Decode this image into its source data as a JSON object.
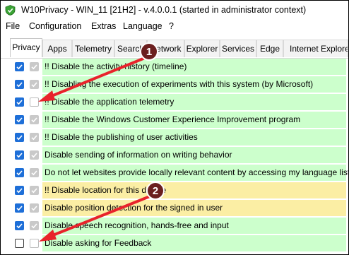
{
  "window": {
    "title": "W10Privacy - WIN_11 [21H2]  - v.4.0.0.1 (started in administrator context)",
    "icon": "w10privacy-app-icon"
  },
  "menu": [
    "File",
    "Configuration",
    "Extras",
    "Language",
    "?"
  ],
  "tabs": [
    {
      "label": "Privacy",
      "active": true
    },
    {
      "label": "Apps"
    },
    {
      "label": "Telemetry"
    },
    {
      "label": "Search"
    },
    {
      "label": "Network"
    },
    {
      "label": "Explorer"
    },
    {
      "label": "Services"
    },
    {
      "label": "Edge"
    },
    {
      "label": "Internet Explorer"
    }
  ],
  "settings": [
    {
      "label": "!! Disable the activity history (timeline)",
      "user": true,
      "sys": true,
      "color": "green"
    },
    {
      "label": "!! Disabling the execution of experiments with this system (by Microsoft)",
      "user": true,
      "sys": true,
      "color": "green"
    },
    {
      "label": "!! Disable the application telemetry",
      "user": true,
      "sys": false,
      "color": "green"
    },
    {
      "label": "!! Disable the Windows Customer Experience Improvement program",
      "user": true,
      "sys": true,
      "color": "green"
    },
    {
      "label": "!! Disable the publishing of user activities",
      "user": true,
      "sys": true,
      "color": "green"
    },
    {
      "label": "Disable sending of information on writing behavior",
      "user": true,
      "sys": true,
      "color": "green"
    },
    {
      "label": "Do not let websites provide locally relevant content by accessing my language list",
      "user": true,
      "sys": true,
      "color": "green"
    },
    {
      "label": "!! Disable location for this device",
      "user": true,
      "sys": true,
      "color": "yellow"
    },
    {
      "label": "Disable position detection for the signed in user",
      "user": true,
      "sys": true,
      "color": "yellow"
    },
    {
      "label": "Disable speech recognition, hands-free and input",
      "user": true,
      "sys": true,
      "color": "green"
    },
    {
      "label": "Disable asking for Feedback",
      "user": false,
      "sys": false,
      "color": "green"
    }
  ],
  "annotations": [
    {
      "number": "1",
      "arrow_color": "#e8232b",
      "badge_color": "#6b1f1f"
    },
    {
      "number": "2",
      "arrow_color": "#e8232b",
      "badge_color": "#6b1f1f"
    }
  ],
  "colors": {
    "checkbox_blue": "#1e6fd8",
    "checkbox_gray": "#c9c9c9",
    "row_green": "#ccffcc",
    "row_yellow": "#fbeea4"
  }
}
